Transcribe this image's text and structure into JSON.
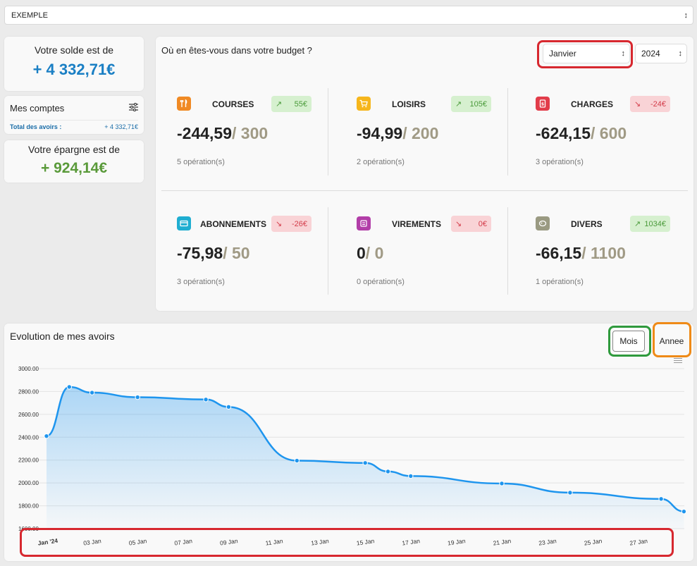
{
  "account_select": {
    "value": "EXEMPLE"
  },
  "solde": {
    "title": "Votre solde est de",
    "value": "+ 4 332,71€"
  },
  "comptes": {
    "title": "Mes comptes",
    "total_label": "Total des avoirs :",
    "total_value": "+ 4 332,71€"
  },
  "epargne": {
    "title": "Votre épargne est de",
    "value": "+ 924,14€"
  },
  "budget": {
    "question": "Où en êtes-vous dans votre budget ?",
    "month": "Janvier",
    "year": "2024",
    "categories": [
      {
        "name": "COURSES",
        "badge": "55€",
        "trend": "up",
        "spent": "-244,59",
        "limit": "/ 300",
        "ops": "5 opération(s)",
        "color": "#f08a24",
        "icon": "fork-knife-icon"
      },
      {
        "name": "LOISIRS",
        "badge": "105€",
        "trend": "up",
        "spent": "-94,99",
        "limit": "/ 200",
        "ops": "2 opération(s)",
        "color": "#f6b61c",
        "icon": "cart-icon"
      },
      {
        "name": "CHARGES",
        "badge": "-24€",
        "trend": "down",
        "spent": "-624,15",
        "limit": "/ 600",
        "ops": "3 opération(s)",
        "color": "#e23c4a",
        "icon": "bill-icon"
      },
      {
        "name": "ABONNEMENTS",
        "badge": "-26€",
        "trend": "down",
        "spent": "-75,98",
        "limit": "/ 50",
        "ops": "3 opération(s)",
        "color": "#1faed1",
        "icon": "card-icon"
      },
      {
        "name": "VIREMENTS",
        "badge": "0€",
        "trend": "down",
        "spent": "0",
        "limit": "/ 0",
        "ops": "0 opération(s)",
        "color": "#b23ea8",
        "icon": "transfer-icon"
      },
      {
        "name": "DIVERS",
        "badge": "1034€",
        "trend": "up",
        "spent": "-66,15",
        "limit": "/ 1100",
        "ops": "1 opération(s)",
        "color": "#9a9a82",
        "icon": "misc-icon"
      }
    ]
  },
  "evolution": {
    "title": "Evolution de mes avoirs",
    "btn_mois": "Mois",
    "btn_annee": "Annee"
  },
  "chart_data": {
    "type": "area",
    "title": "",
    "xlabel": "",
    "ylabel": "",
    "ylim": [
      1600,
      3000
    ],
    "yticks": [
      "1600.00",
      "1800.00",
      "2000.00",
      "2200.00",
      "2400.00",
      "2600.00",
      "2800.00",
      "3000.00"
    ],
    "xticks": [
      "Jan '24",
      "03 Jan",
      "05 Jan",
      "07 Jan",
      "09 Jan",
      "11 Jan",
      "13 Jan",
      "15 Jan",
      "17 Jan",
      "19 Jan",
      "21 Jan",
      "23 Jan",
      "25 Jan",
      "27 Jan"
    ],
    "x_days": [
      1,
      2,
      3,
      5,
      8,
      9,
      12,
      15,
      16,
      17,
      21,
      24,
      28,
      29
    ],
    "y": [
      2410,
      2840,
      2790,
      2750,
      2730,
      2665,
      2195,
      2175,
      2100,
      2060,
      1995,
      1915,
      1860,
      1750
    ],
    "grid": true,
    "color": "#1e95ee"
  }
}
